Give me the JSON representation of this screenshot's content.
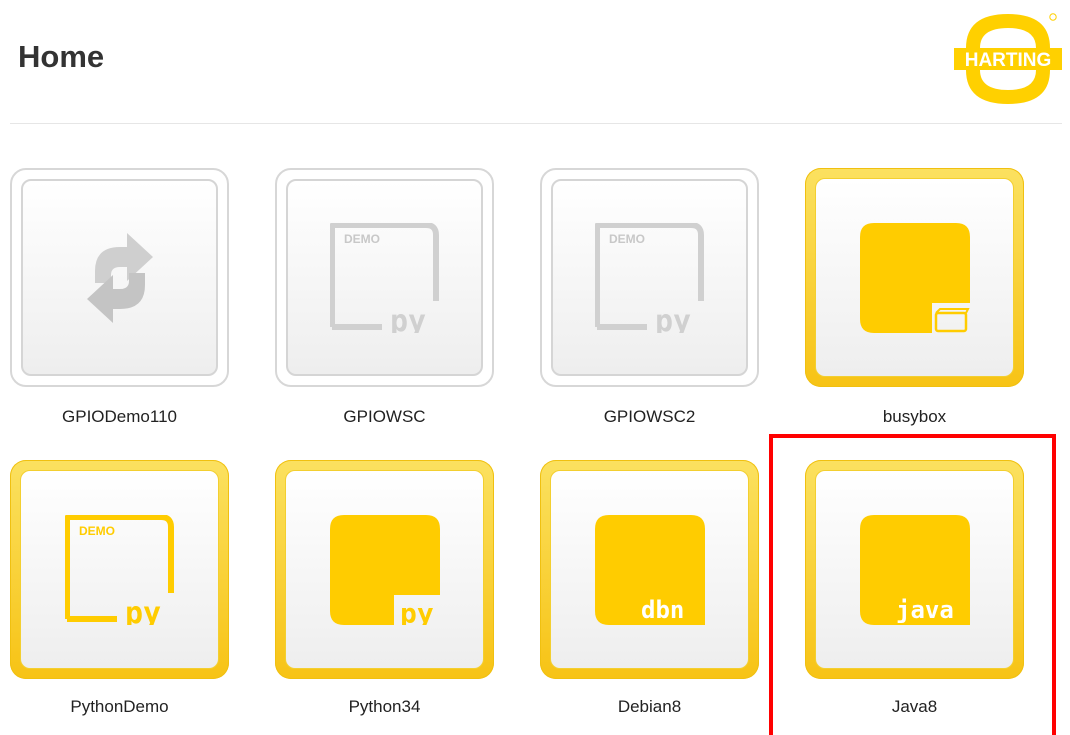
{
  "header": {
    "title": "Home",
    "logo_text": "HARTING",
    "logo_color": "#ffd000"
  },
  "apps": [
    {
      "name": "GPIODemo110",
      "style": "grey",
      "icon": "refresh-arrows-icon"
    },
    {
      "name": "GPIOWSC",
      "style": "grey",
      "icon": "demo-py-icon",
      "icon_tag": "DEMO",
      "icon_text": "py"
    },
    {
      "name": "GPIOWSC2",
      "style": "grey",
      "icon": "demo-py-icon",
      "icon_tag": "DEMO",
      "icon_text": "py"
    },
    {
      "name": "busybox",
      "style": "yellow",
      "icon": "container-box-icon"
    },
    {
      "name": "PythonDemo",
      "style": "yellow",
      "icon": "demo-py-icon",
      "icon_tag": "DEMO",
      "icon_text": "py"
    },
    {
      "name": "Python34",
      "style": "yellow",
      "icon": "py-icon",
      "icon_text": "py"
    },
    {
      "name": "Debian8",
      "style": "yellow",
      "icon": "dbn-icon",
      "icon_text": "dbn"
    },
    {
      "name": "Java8",
      "style": "yellow",
      "icon": "java-icon",
      "icon_text": "java"
    }
  ],
  "colors": {
    "accent_yellow": "#ffcc00",
    "grey_icon": "#d0d0d0",
    "highlight_red": "#ff0000"
  }
}
